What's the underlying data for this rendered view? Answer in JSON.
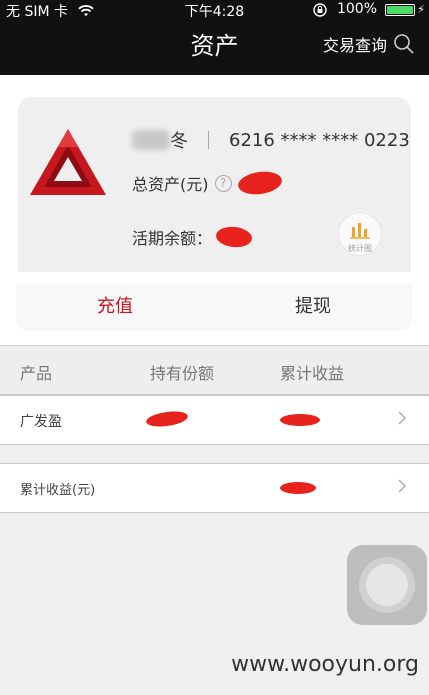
{
  "status_bar": {
    "carrier": "无 SIM 卡",
    "time": "下午4:28",
    "battery": "100%"
  },
  "nav": {
    "title": "资产",
    "action": "交易查询"
  },
  "account": {
    "name_suffix": "冬",
    "card_number": "6216 **** **** 0223",
    "total_label": "总资产(元)",
    "balance_label": "活期余额：",
    "chart_label": "统计图"
  },
  "actions": {
    "recharge": "充值",
    "withdraw": "提现"
  },
  "table": {
    "headers": [
      "产品",
      "持有份额",
      "累计收益"
    ],
    "product_row": "广发盈",
    "summary_row": "累计收益(元)"
  },
  "watermark": "www.wooyun.org",
  "colors": {
    "accent": "#c9151e",
    "bars": "#111111",
    "battery": "#4cd964"
  }
}
